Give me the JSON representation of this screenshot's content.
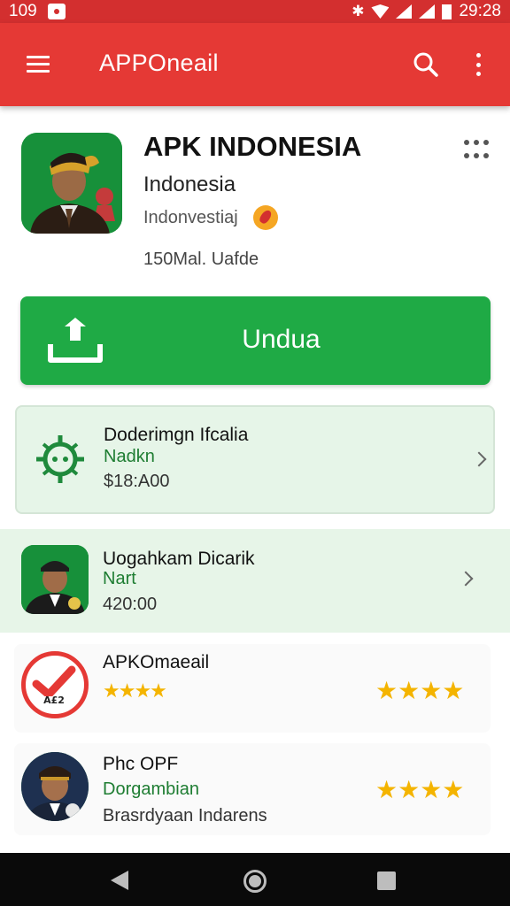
{
  "status_bar": {
    "left_text": "109",
    "time": "29:28"
  },
  "app_bar": {
    "title": "APPOneail"
  },
  "app": {
    "name": "APK INDONESIA",
    "developer": "Indonesia",
    "category": "Indonvestiaj",
    "size": "150Mal. Uafde"
  },
  "download": {
    "label": "Undua"
  },
  "list": [
    {
      "title": "Doderimgn Ifcalia",
      "subtitle": "Nadkn",
      "price": "$18:A00"
    },
    {
      "title": "Uogahkam Dicarik",
      "subtitle": "Nart",
      "price": "420:00"
    },
    {
      "title": "APKOmaeail",
      "stars_label": "★★★★",
      "stars": "★★★★"
    },
    {
      "title": "Phc OPF",
      "subtitle": "Dorgambian",
      "extra": "Brasrdyaan Indarens",
      "stars": "★★★★"
    }
  ],
  "colors": {
    "app_bar": "#e53935",
    "status_bar": "#d32f2f",
    "download": "#1faa45",
    "card_bg": "#e6f5e8",
    "accent_text": "#1e7d32",
    "stars": "#f4b400"
  },
  "icons": [
    "menu-icon",
    "search-icon",
    "more-vert-icon",
    "grid-dots-icon",
    "upload-icon",
    "bug-icon",
    "chevron-right-icon",
    "checkmark-badge-icon",
    "back-icon",
    "home-icon",
    "recents-icon"
  ]
}
